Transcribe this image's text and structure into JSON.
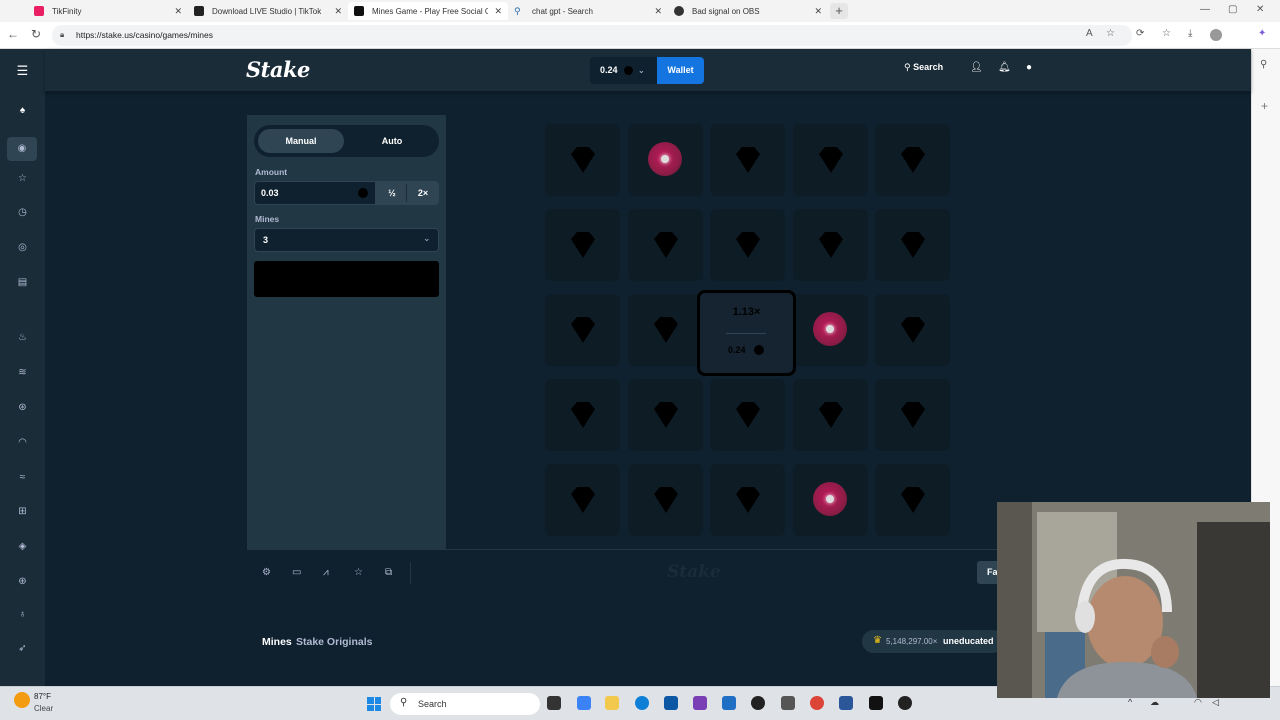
{
  "browser": {
    "tabs": [
      {
        "title": "TikFinity",
        "favicon_color": "#e91e63",
        "active": false
      },
      {
        "title": "Download LIVE Studio | TikTok",
        "favicon_color": "#222222",
        "active": false
      },
      {
        "title": "Mines Game - Play Free Social Ca",
        "favicon_color": "#111111",
        "active": true
      },
      {
        "title": "chat gpt - Search",
        "favicon_color": "#2b6cb0",
        "active": false
      },
      {
        "title": "Bad signal on OBS",
        "favicon_color": "#333333",
        "active": false
      }
    ],
    "url": "https://stake.us/casino/games/mines"
  },
  "stake": {
    "logo": "Stake",
    "balance": "0.24",
    "wallet_label": "Wallet",
    "search_label": "Search"
  },
  "game": {
    "mode_manual": "Manual",
    "mode_auto": "Auto",
    "amount_label": "Amount",
    "amount_value": "0.03",
    "half_label": "½",
    "double_label": "2×",
    "mines_label": "Mines",
    "mines_value": "3",
    "grid": [
      [
        "gem",
        "mine",
        "gem",
        "gem",
        "gem"
      ],
      [
        "gem",
        "gem",
        "gem",
        "gem",
        "gem"
      ],
      [
        "gem",
        "gem",
        "cashout",
        "mine",
        "gem"
      ],
      [
        "gem",
        "gem",
        "gem",
        "gem",
        "gem"
      ],
      [
        "gem",
        "gem",
        "gem",
        "mine",
        "gem"
      ]
    ],
    "cashout_multiplier": "1.13×",
    "cashout_profit": "0.24",
    "watermark": "Stake",
    "fairness_label": "Fa"
  },
  "info": {
    "game_name": "Mines",
    "game_subtitle": "Stake Originals",
    "top_win_amount": "5,148,297.00×",
    "top_win_user": "uneducated"
  },
  "taskbar": {
    "weather_temp": "87°F",
    "weather_cond": "Clear",
    "search_label": "Search"
  },
  "colors": {
    "accent": "#1475e1",
    "panel": "#213743",
    "background": "#0f212e",
    "mine": "#c2185b"
  }
}
